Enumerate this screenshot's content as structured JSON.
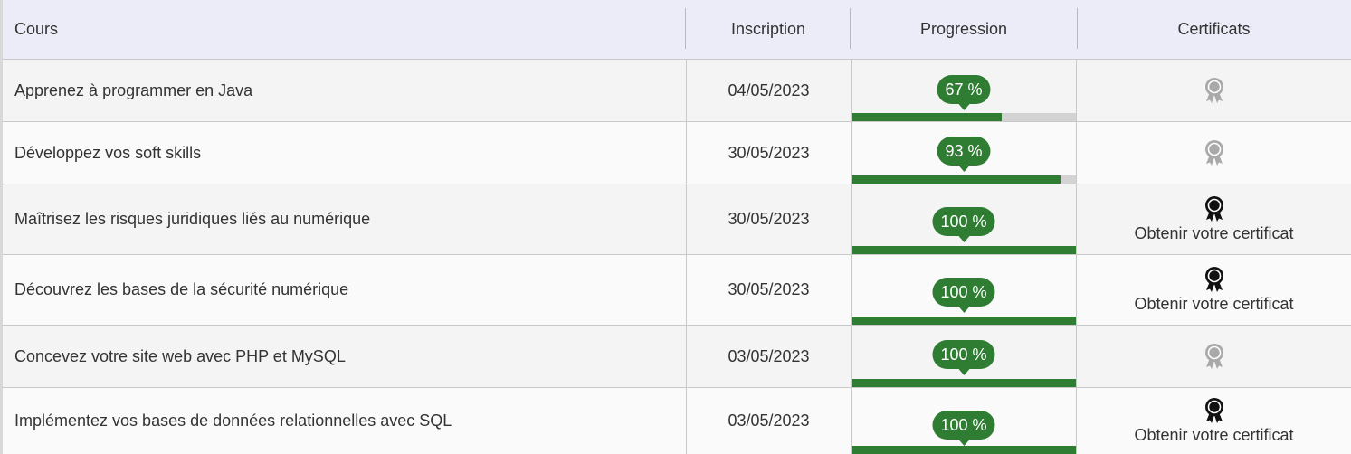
{
  "header": {
    "course": "Cours",
    "inscription": "Inscription",
    "progression": "Progression",
    "certificates": "Certificats"
  },
  "rows": [
    {
      "course": "Apprenez à programmer en Java",
      "date": "04/05/2023",
      "progress_label": "67 %",
      "progress": 0.67,
      "cert_state": "locked",
      "cert_label": ""
    },
    {
      "course": "Développez vos soft skills",
      "date": "30/05/2023",
      "progress_label": "93 %",
      "progress": 0.93,
      "cert_state": "locked",
      "cert_label": ""
    },
    {
      "course": "Maîtrisez les risques juridiques liés au numérique",
      "date": "30/05/2023",
      "progress_label": "100 %",
      "progress": 1.0,
      "cert_state": "available",
      "cert_label": "Obtenir votre certificat"
    },
    {
      "course": "Découvrez les bases de la sécurité numérique",
      "date": "30/05/2023",
      "progress_label": "100 %",
      "progress": 1.0,
      "cert_state": "available",
      "cert_label": "Obtenir votre certificat"
    },
    {
      "course": "Concevez votre site web avec PHP et MySQL",
      "date": "03/05/2023",
      "progress_label": "100 %",
      "progress": 1.0,
      "cert_state": "locked",
      "cert_label": ""
    },
    {
      "course": "Implémentez vos bases de données relationnelles avec SQL",
      "date": "03/05/2023",
      "progress_label": "100 %",
      "progress": 1.0,
      "cert_state": "available",
      "cert_label": "Obtenir votre certificat"
    }
  ],
  "icons": {
    "locked": "award-medal-icon-grey",
    "available": "award-medal-icon-black"
  },
  "colors": {
    "header_bg": "#ecebf8",
    "progress_green": "#2e7d32",
    "progress_track": "#d3d3d3",
    "medal_locked": "#a9a9a9",
    "medal_available": "#111111"
  }
}
